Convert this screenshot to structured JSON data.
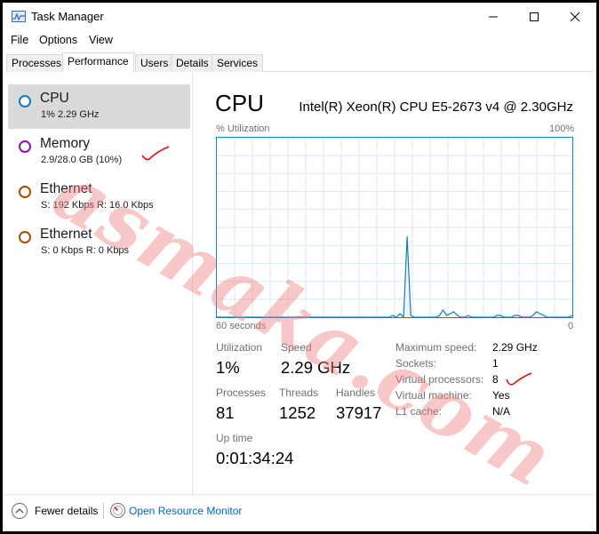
{
  "window": {
    "title": "Task Manager",
    "icons": {
      "app": "task-manager-icon",
      "minimize": "minimize-icon",
      "maximize": "maximize-icon",
      "close": "close-icon"
    }
  },
  "menu": {
    "items": [
      "File",
      "Options",
      "View"
    ]
  },
  "tabs": [
    "Processes",
    "Performance",
    "Users",
    "Details",
    "Services"
  ],
  "active_tab": "Performance",
  "resources": [
    {
      "name": "CPU",
      "sub": "1%  2.29 GHz",
      "color": "#117dbb",
      "selected": true
    },
    {
      "name": "Memory",
      "sub": "2.9/28.0 GB (10%)",
      "color": "#8b12ae",
      "selected": false
    },
    {
      "name": "Ethernet",
      "sub": "S: 192 Kbps  R: 16.0 Kbps",
      "color": "#a74f01",
      "selected": false
    },
    {
      "name": "Ethernet",
      "sub": "S: 0 Kbps  R: 0 Kbps",
      "color": "#a74f01",
      "selected": false
    }
  ],
  "cpu": {
    "title": "CPU",
    "model": "Intel(R) Xeon(R) CPU E5-2673 v4 @ 2.30GHz",
    "graph": {
      "label": "% Utilization",
      "max_label": "100%",
      "time_label": "60 seconds",
      "min_label": "0",
      "samples": [
        0,
        0,
        0,
        0,
        0,
        0,
        0,
        0,
        0,
        0,
        0,
        0,
        0,
        0,
        0,
        0,
        0,
        0,
        0,
        0,
        0,
        0,
        0,
        0,
        0,
        0,
        0,
        0,
        0,
        0,
        0,
        0,
        0,
        0,
        0,
        0,
        0,
        0,
        0,
        0,
        0,
        0,
        0,
        0,
        0,
        0,
        0,
        0,
        0,
        1,
        0,
        2,
        0,
        45,
        1,
        0,
        0,
        0,
        0,
        0,
        0,
        0,
        1,
        4,
        1,
        2,
        3,
        1,
        0,
        0,
        1,
        0,
        0,
        0,
        0,
        0,
        0,
        0,
        1,
        1,
        0,
        0,
        0,
        1,
        1,
        0,
        0,
        0,
        1,
        3,
        2,
        1,
        0,
        0,
        0,
        0,
        0,
        0,
        0,
        1
      ],
      "line_color": "#117dbb",
      "fill_color": "#f1f6fa",
      "grid_color": "#d9eaf4"
    },
    "stats": {
      "utilization_label": "Utilization",
      "utilization": "1%",
      "speed_label": "Speed",
      "speed": "2.29 GHz",
      "processes_label": "Processes",
      "processes": "81",
      "threads_label": "Threads",
      "threads": "1252",
      "handles_label": "Handles",
      "handles": "37917",
      "uptime_label": "Up time",
      "uptime": "0:01:34:24"
    },
    "details": [
      {
        "label": "Maximum speed:",
        "value": "2.29 GHz"
      },
      {
        "label": "Sockets:",
        "value": "1"
      },
      {
        "label": "Virtual processors:",
        "value": "8"
      },
      {
        "label": "Virtual machine:",
        "value": "Yes"
      },
      {
        "label": "L1 cache:",
        "value": "N/A"
      }
    ]
  },
  "footer": {
    "fewer_details": "Fewer details",
    "open_resource_monitor": "Open Resource Monitor"
  },
  "watermark": "asmaka.com",
  "annotation_color": "#e01010"
}
